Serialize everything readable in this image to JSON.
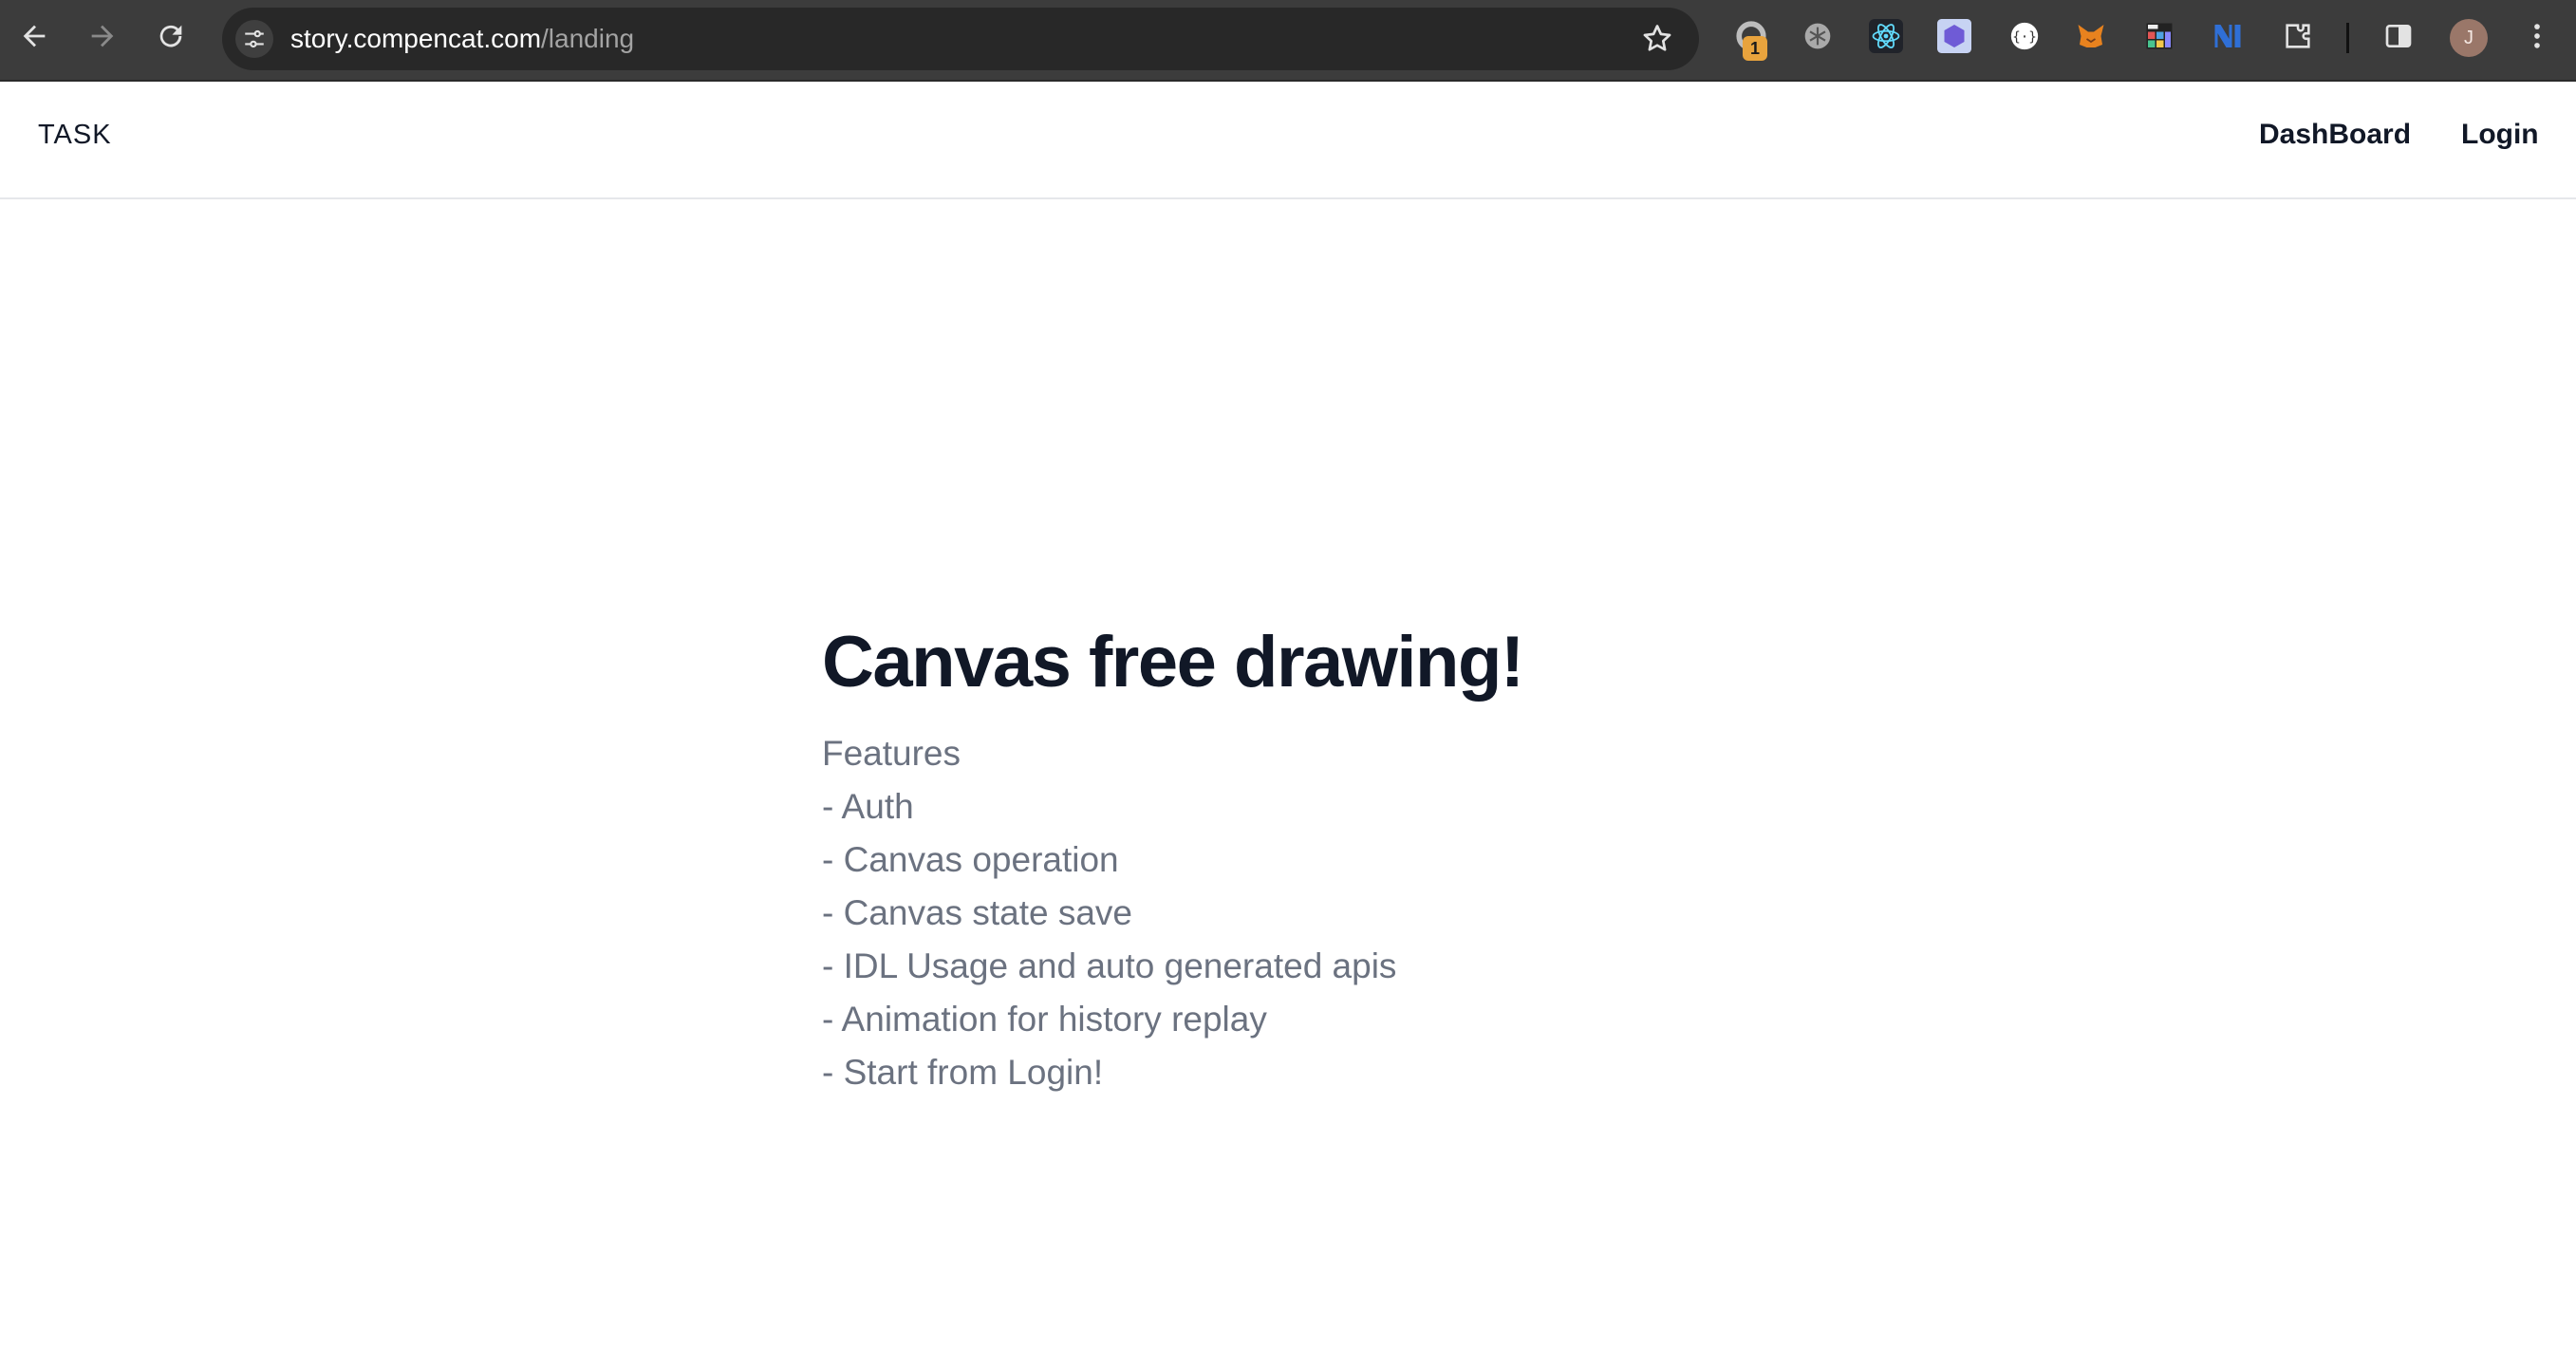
{
  "browser": {
    "url_domain": "story.compencat.com",
    "url_path": "/landing",
    "extension_badge": "1",
    "profile_initial": "J",
    "icons": [
      "back-arrow-icon",
      "forward-arrow-icon",
      "reload-icon",
      "site-settings-icon",
      "bookmark-star-icon",
      "extension-icons",
      "puzzle-extensions-icon",
      "side-panel-icon",
      "kebab-menu-icon"
    ]
  },
  "header": {
    "brand": "TASK",
    "nav": {
      "dashboard": "DashBoard",
      "login": "Login"
    }
  },
  "hero": {
    "title": "Canvas free drawing!",
    "features_heading": "Features",
    "features": [
      "- Auth",
      "- Canvas operation",
      "- Canvas state save",
      "- IDL Usage and auto generated apis",
      "- Animation for history replay",
      "- Start from Login!"
    ]
  },
  "colors": {
    "chrome": "#3c3c3c",
    "omnibox": "#282828",
    "text_dark": "#111827",
    "text_muted": "#6b7280",
    "border": "#e5e7eb"
  }
}
